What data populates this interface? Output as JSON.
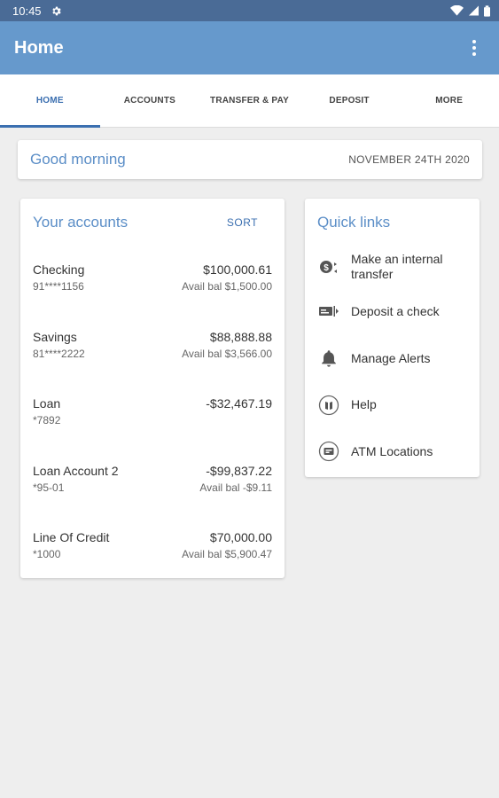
{
  "status": {
    "time": "10:45"
  },
  "appbar": {
    "title": "Home"
  },
  "tabs": [
    {
      "label": "HOME",
      "active": true
    },
    {
      "label": "ACCOUNTS",
      "active": false
    },
    {
      "label": "TRANSFER & PAY",
      "active": false
    },
    {
      "label": "DEPOSIT",
      "active": false
    },
    {
      "label": "MORE",
      "active": false
    }
  ],
  "greeting": {
    "text": "Good morning",
    "date": "NOVEMBER 24TH 2020"
  },
  "accounts": {
    "title": "Your accounts",
    "sort_label": "SORT",
    "items": [
      {
        "name": "Checking",
        "number": "91****1156",
        "amount": "$100,000.61",
        "avail": "Avail bal $1,500.00"
      },
      {
        "name": "Savings",
        "number": "81****2222",
        "amount": "$88,888.88",
        "avail": "Avail bal $3,566.00"
      },
      {
        "name": "Loan",
        "number": "*7892",
        "amount": "-$32,467.19",
        "avail": ""
      },
      {
        "name": "Loan Account 2",
        "number": "*95-01",
        "amount": "-$99,837.22",
        "avail": "Avail bal -$9.11"
      },
      {
        "name": "Line Of Credit",
        "number": "*1000",
        "amount": "$70,000.00",
        "avail": "Avail bal $5,900.47"
      }
    ]
  },
  "quick_links": {
    "title": "Quick links",
    "items": [
      {
        "label": "Make an internal transfer",
        "icon": "transfer-icon"
      },
      {
        "label": "Deposit a check",
        "icon": "check-deposit-icon"
      },
      {
        "label": "Manage Alerts",
        "icon": "bell-icon"
      },
      {
        "label": "Help",
        "icon": "help-icon"
      },
      {
        "label": "ATM Locations",
        "icon": "atm-icon"
      }
    ]
  },
  "colors": {
    "appbar": "#6699cc",
    "statusbar": "#4a6b96",
    "accent": "#3b6fb0",
    "heading": "#5b8ec7"
  }
}
